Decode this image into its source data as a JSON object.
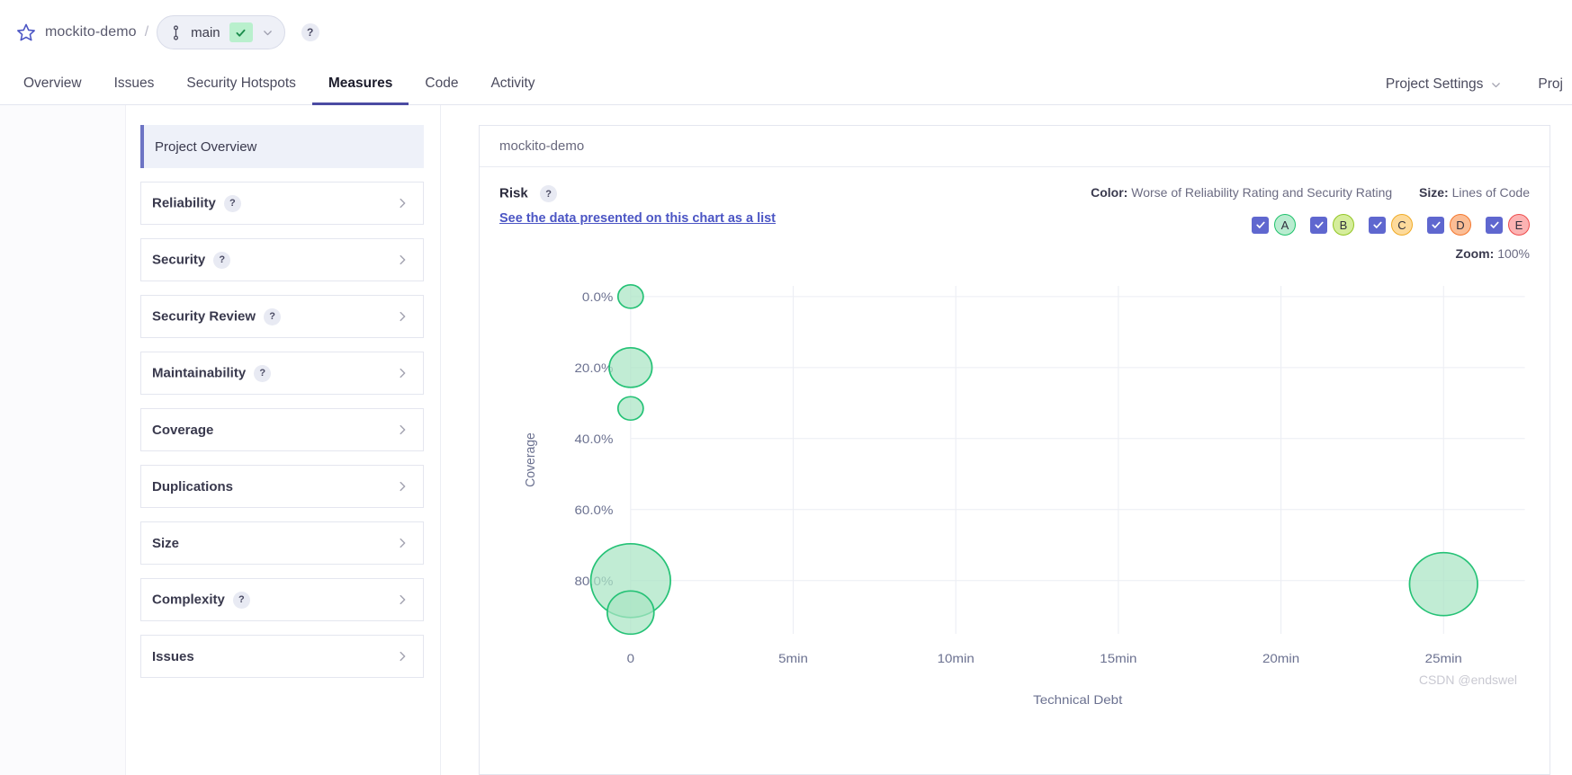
{
  "header": {
    "star_icon": "star-icon",
    "project": "mockito-demo",
    "separator": "/",
    "branch": "main",
    "branch_icon": "branch-icon",
    "branch_status_icon": "check-icon",
    "branch_dropdown_icon": "chevron-down-icon",
    "help_icon": "?"
  },
  "nav": {
    "items": [
      {
        "label": "Overview",
        "active": false
      },
      {
        "label": "Issues",
        "active": false
      },
      {
        "label": "Security Hotspots",
        "active": false
      },
      {
        "label": "Measures",
        "active": true
      },
      {
        "label": "Code",
        "active": false
      },
      {
        "label": "Activity",
        "active": false
      }
    ],
    "right": [
      {
        "label": "Project Settings",
        "caret": true
      },
      {
        "label": "Proj",
        "caret": false
      }
    ]
  },
  "sidebar": {
    "items": [
      {
        "label": "Project Overview",
        "help": false,
        "arrow": false,
        "selected": true
      },
      {
        "label": "Reliability",
        "help": true,
        "arrow": true,
        "selected": false
      },
      {
        "label": "Security",
        "help": true,
        "arrow": true,
        "selected": false
      },
      {
        "label": "Security Review",
        "help": true,
        "arrow": true,
        "selected": false
      },
      {
        "label": "Maintainability",
        "help": true,
        "arrow": true,
        "selected": false
      },
      {
        "label": "Coverage",
        "help": false,
        "arrow": true,
        "selected": false
      },
      {
        "label": "Duplications",
        "help": false,
        "arrow": true,
        "selected": false
      },
      {
        "label": "Size",
        "help": false,
        "arrow": true,
        "selected": false
      },
      {
        "label": "Complexity",
        "help": true,
        "arrow": true,
        "selected": false
      },
      {
        "label": "Issues",
        "help": false,
        "arrow": true,
        "selected": false
      }
    ]
  },
  "card": {
    "title": "mockito-demo",
    "risk_title": "Risk",
    "risk_help": "?",
    "data_list_link": "See the data presented on this chart as a list",
    "color_label": "Color:",
    "color_value": "Worse of Reliability Rating and Security Rating",
    "size_label": "Size:",
    "size_value": "Lines of Code",
    "zoom_label": "Zoom:",
    "zoom_value": "100%",
    "ratings": [
      {
        "letter": "A",
        "checked": true,
        "fill": "#b9ecd0",
        "stroke": "#1ec26b"
      },
      {
        "letter": "B",
        "checked": true,
        "fill": "#d5ed9b",
        "stroke": "#93c624"
      },
      {
        "letter": "C",
        "checked": true,
        "fill": "#fdda9b",
        "stroke": "#efab26"
      },
      {
        "letter": "D",
        "checked": true,
        "fill": "#fbbd95",
        "stroke": "#f4762c"
      },
      {
        "letter": "E",
        "checked": true,
        "fill": "#fcb3b3",
        "stroke": "#ee4c4c"
      }
    ]
  },
  "watermark": "CSDN @endswel",
  "chart_data": {
    "type": "scatter",
    "title": "Risk",
    "xlabel": "Technical Debt",
    "ylabel": "Coverage",
    "x_ticks": [
      "0",
      "5min",
      "10min",
      "15min",
      "20min",
      "25min"
    ],
    "x_tick_values": [
      0,
      5,
      10,
      15,
      20,
      25
    ],
    "y_ticks": [
      "0.0%",
      "20.0%",
      "40.0%",
      "60.0%",
      "80.0%"
    ],
    "y_tick_values": [
      0,
      20,
      40,
      60,
      80
    ],
    "xlim": [
      0,
      27.5
    ],
    "ylim": [
      -3,
      95
    ],
    "y_inverted": true,
    "grid": true,
    "legend_position": "top-right",
    "bubble_color_fill": "#a9e5c4",
    "bubble_color_stroke": "#25c276",
    "points": [
      {
        "x": 0,
        "y": 0,
        "r": 13,
        "rating": "A",
        "size_metric": "Lines of Code"
      },
      {
        "x": 0,
        "y": 20,
        "r": 22,
        "rating": "A",
        "size_metric": "Lines of Code"
      },
      {
        "x": 0,
        "y": 31.5,
        "r": 13,
        "rating": "A",
        "size_metric": "Lines of Code"
      },
      {
        "x": 0,
        "y": 80,
        "r": 41,
        "rating": "A",
        "size_metric": "Lines of Code"
      },
      {
        "x": 0,
        "y": 89,
        "r": 24,
        "rating": "A",
        "size_metric": "Lines of Code"
      },
      {
        "x": 25,
        "y": 81,
        "r": 35,
        "rating": "A",
        "size_metric": "Lines of Code"
      }
    ]
  }
}
